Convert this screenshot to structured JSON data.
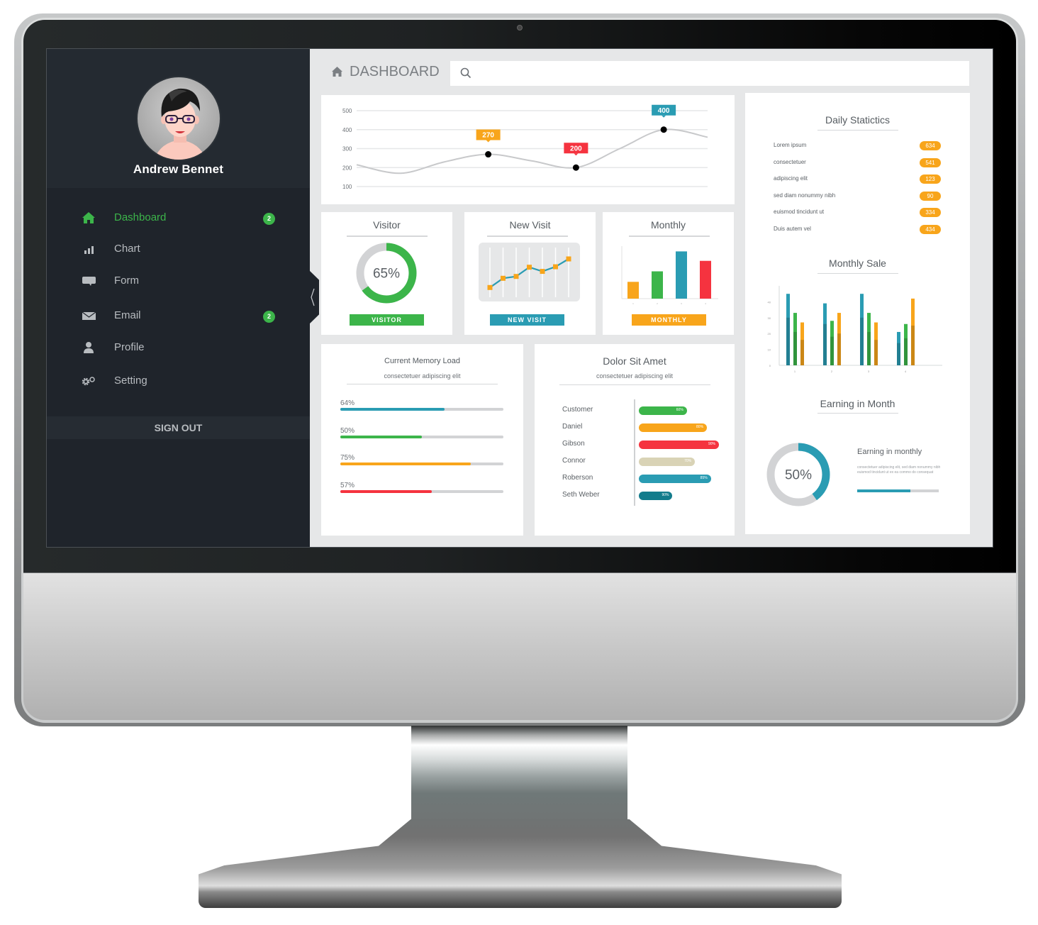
{
  "user": {
    "name": "Andrew Bennet"
  },
  "sidebar": {
    "items": [
      {
        "label": "Dashboard",
        "icon": "home-icon",
        "active": true,
        "badge": "2"
      },
      {
        "label": "Chart",
        "icon": "bar-chart-icon",
        "active": false,
        "badge": null
      },
      {
        "label": "Form",
        "icon": "chat-bubble-icon",
        "active": false,
        "badge": null
      },
      {
        "label": "Email",
        "icon": "envelope-icon",
        "active": false,
        "badge": "2"
      },
      {
        "label": "Profile",
        "icon": "user-icon",
        "active": false,
        "badge": null
      },
      {
        "label": "Setting",
        "icon": "gears-icon",
        "active": false,
        "badge": null
      }
    ],
    "signout_label": "SIGN OUT",
    "collapse_icon": "chevron-left-icon"
  },
  "header": {
    "title": "DASHBOARD",
    "title_icon": "home-icon",
    "search": {
      "placeholder": "",
      "value": "",
      "icon": "search-icon"
    }
  },
  "colors": {
    "green": "#3cb54a",
    "orange": "#f8a51b",
    "red": "#f5333f",
    "teal": "#2a9cb3",
    "dark_teal": "#137c8c",
    "beige": "#d9d3b6",
    "sidebar_bg": "#1f242b",
    "screen_bg": "#e6e7e8"
  },
  "chart_data": [
    {
      "id": "overview-line",
      "type": "line",
      "title": "",
      "y_ticks": [
        100,
        200,
        300,
        400,
        500
      ],
      "ylim": [
        100,
        500
      ],
      "x": [
        0,
        1,
        2,
        3,
        4,
        5,
        6,
        7,
        8
      ],
      "values": [
        215,
        170,
        230,
        270,
        235,
        200,
        300,
        400,
        360
      ],
      "highlighted_points": [
        {
          "index": 3,
          "label": "270",
          "color": "#f8a51b"
        },
        {
          "index": 5,
          "label": "200",
          "color": "#f5333f"
        },
        {
          "index": 7,
          "label": "400",
          "color": "#2a9cb3"
        }
      ],
      "grid": true
    },
    {
      "id": "visitor-donut",
      "type": "pie",
      "title": "Visitor",
      "value_percent": 65,
      "center_label": "65%",
      "button_label": "VISITOR",
      "color": "#3cb54a"
    },
    {
      "id": "new-visit-line",
      "type": "line",
      "title": "New Visit",
      "values": [
        18,
        38,
        42,
        62,
        53,
        63,
        80
      ],
      "ylim": [
        0,
        100
      ],
      "button_label": "NEW VISIT",
      "color": "#2a9cb3",
      "marker_color": "#f8a51b"
    },
    {
      "id": "monthly-bar",
      "type": "bar",
      "title": "Monthly",
      "categories": [
        "1",
        "2",
        "3",
        "4"
      ],
      "values": [
        16,
        26,
        45,
        36
      ],
      "colors": [
        "#f8a51b",
        "#3cb54a",
        "#2a9cb3",
        "#f5333f"
      ],
      "ylim": [
        0,
        50
      ],
      "button_label": "MONTHLY"
    },
    {
      "id": "monthly-sale",
      "type": "bar",
      "title": "Monthly Sale",
      "categories": [
        "1",
        "2",
        "3",
        "4"
      ],
      "y_ticks": [
        0,
        10,
        20,
        30,
        40
      ],
      "ylim": [
        0,
        50
      ],
      "series": [
        {
          "name": "teal",
          "color": "#2a9cb3",
          "values": [
            45,
            39,
            45,
            21
          ],
          "lower_values": [
            30,
            26,
            30,
            14
          ]
        },
        {
          "name": "green",
          "color": "#3cb54a",
          "values": [
            33,
            28,
            33,
            26
          ],
          "lower_values": [
            21,
            18,
            21,
            17
          ]
        },
        {
          "name": "orange",
          "color": "#f8a51b",
          "values": [
            27,
            33,
            27,
            42
          ],
          "lower_values": [
            16,
            20,
            16,
            25
          ]
        }
      ]
    },
    {
      "id": "earning-donut",
      "type": "pie",
      "title": "Earning in Month",
      "value_percent": 40,
      "center_label": "50%",
      "color": "#2a9cb3"
    }
  ],
  "memory": {
    "title": "Current Memory Load",
    "subtitle": "consectetuer adipiscing elit",
    "bars": [
      {
        "label": "64%",
        "value": 64,
        "color": "#2a9cb3"
      },
      {
        "label": "50%",
        "value": 50,
        "color": "#3cb54a"
      },
      {
        "label": "75%",
        "value": 80,
        "color": "#f8a51b"
      },
      {
        "label": "57%",
        "value": 56,
        "color": "#f5333f"
      }
    ]
  },
  "dolor": {
    "title": "Dolor Sit Amet",
    "subtitle": "consectetuer adipiscing elit",
    "rows": [
      {
        "name": "Customer",
        "label": "60%",
        "value": 60,
        "color": "#3cb54a"
      },
      {
        "name": "Daniel",
        "label": "80%",
        "value": 85,
        "color": "#f8a51b"
      },
      {
        "name": "Gibson",
        "label": "90%",
        "value": 100,
        "color": "#f5333f"
      },
      {
        "name": "Connor",
        "label": "70%",
        "value": 70,
        "color": "#d9d3b6"
      },
      {
        "name": "Roberson",
        "label": "85%",
        "value": 90,
        "color": "#2a9cb3"
      },
      {
        "name": "Seth Weber",
        "label": "90%",
        "value": 42,
        "color": "#137c8c"
      }
    ]
  },
  "daily": {
    "title": "Daily Statictics",
    "rows": [
      {
        "label": "Lorem ipsum",
        "value": "634"
      },
      {
        "label": "consectetuer",
        "value": "541"
      },
      {
        "label": "adipiscing elit",
        "value": "123"
      },
      {
        "label": "sed diam nonummy nibh",
        "value": "90"
      },
      {
        "label": "euismod tincidunt ut",
        "value": "334"
      },
      {
        "label": "Duis autem vel",
        "value": "434"
      }
    ]
  },
  "earning": {
    "title": "Earning in Month",
    "heading": "Earning in monthly",
    "body": "consectetuer adipiscing elit, sed diam nonummy nibh euismod tincidunt ut ex ea commo do consequat",
    "progress": 65
  }
}
